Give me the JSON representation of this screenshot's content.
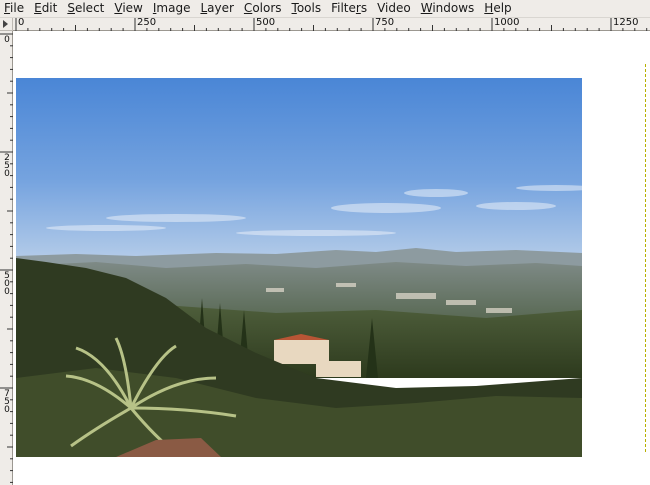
{
  "menu": [
    {
      "label": "File",
      "mnemonic": "F"
    },
    {
      "label": "Edit",
      "mnemonic": "E"
    },
    {
      "label": "Select",
      "mnemonic": "S"
    },
    {
      "label": "View",
      "mnemonic": "V"
    },
    {
      "label": "Image",
      "mnemonic": "I"
    },
    {
      "label": "Layer",
      "mnemonic": "L"
    },
    {
      "label": "Colors",
      "mnemonic": "C"
    },
    {
      "label": "Tools",
      "mnemonic": "T"
    },
    {
      "label": "Filters",
      "mnemonic": "r"
    },
    {
      "label": "Video",
      "mnemonic": ""
    },
    {
      "label": "Windows",
      "mnemonic": "W"
    },
    {
      "label": "Help",
      "mnemonic": "H"
    }
  ],
  "ruler": {
    "horizontal_labels": [
      "0",
      "250",
      "500",
      "750",
      "1000",
      "1250"
    ],
    "vertical_labels": [
      "0",
      "250",
      "500",
      "750"
    ]
  },
  "canvas": {
    "image_description_icon": "landscape-photo"
  }
}
